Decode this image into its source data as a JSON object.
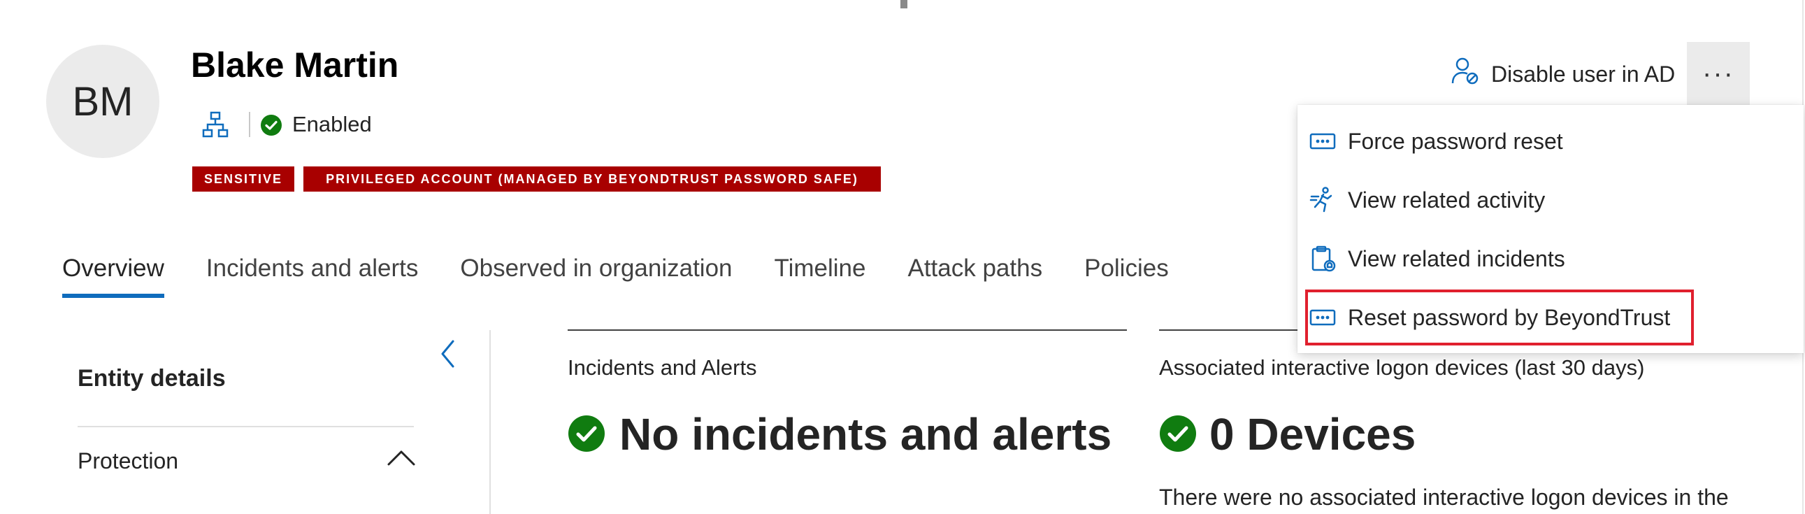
{
  "user": {
    "initials": "BM",
    "name": "Blake Martin",
    "status": "Enabled",
    "tags": [
      "SENSITIVE",
      "PRIVILEGED ACCOUNT (MANAGED BY BEYONDTRUST PASSWORD SAFE)"
    ]
  },
  "header_actions": {
    "disable_label": "Disable user in AD",
    "more_label": "···"
  },
  "tabs": [
    {
      "label": "Overview",
      "active": true
    },
    {
      "label": "Incidents and alerts",
      "active": false
    },
    {
      "label": "Observed in organization",
      "active": false
    },
    {
      "label": "Timeline",
      "active": false
    },
    {
      "label": "Attack paths",
      "active": false
    },
    {
      "label": "Policies",
      "active": false
    }
  ],
  "entity_details": {
    "title": "Entity details",
    "section": "Protection"
  },
  "cards": [
    {
      "title": "Incidents and Alerts",
      "stat": "No incidents and alerts"
    },
    {
      "title": "Associated interactive logon devices (last 30 days)",
      "stat": "0 Devices",
      "description": "There were no associated interactive logon devices in the"
    }
  ],
  "menu": {
    "items": [
      {
        "label": "Force password reset",
        "icon": "password-icon"
      },
      {
        "label": "View related activity",
        "icon": "running-person-icon"
      },
      {
        "label": "View related incidents",
        "icon": "clipboard-alert-icon"
      },
      {
        "label": "Reset password by BeyondTrust",
        "icon": "password-icon",
        "highlighted": true
      }
    ]
  },
  "colors": {
    "accent": "#0f6cbd",
    "success": "#107c10",
    "tag_bg": "#a80000",
    "highlight_border": "#e0202e"
  }
}
